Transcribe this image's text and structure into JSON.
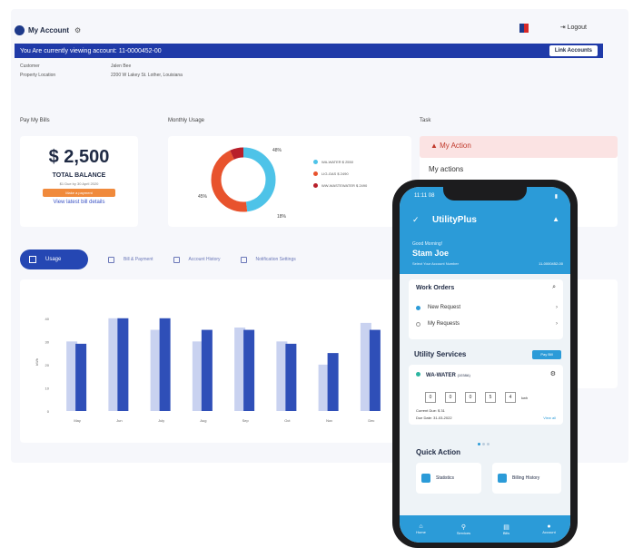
{
  "header": {
    "account_title": "My Account",
    "logout_label": "Logout"
  },
  "banner": {
    "text": "You Are currently viewing account: 11-0000452-00",
    "link_accounts": "Link Accounts"
  },
  "info": {
    "customer_label": "Customer",
    "customer_value": "Jalen Bee",
    "location_label": "Property Location",
    "location_value": "2200 W Lakey St. Lother, Louisiana"
  },
  "bills": {
    "section": "Pay My Bills",
    "amount": "$ 2,500",
    "label": "TOTAL BALANCE",
    "due": "$1 Due by 30 April 2020",
    "pay_button": "Make a payment",
    "view_bill": "View latest bill details"
  },
  "usage": {
    "section": "Monthly Usage",
    "legend": [
      "WA-WATER $ 2550",
      "LIG-GAS $ 2490",
      "WW-WASTEWATER $ 2490"
    ],
    "pct_top": "48%",
    "pct_left": "45%",
    "pct_bottom": "18%",
    "colors": {
      "water": "#4ec3e8",
      "gas": "#e8532d",
      "waste": "#b81f2a"
    }
  },
  "tasks": {
    "section": "Task",
    "action": "My Action",
    "my_actions": "My actions"
  },
  "tabs": {
    "usage": "Usage",
    "bill": "Bill & Payment",
    "history": "Account History",
    "notif": "Notification Settings"
  },
  "chart_data": {
    "type": "bar",
    "categories": [
      "May",
      "Jun",
      "July",
      "Aug",
      "Sep",
      "Oct",
      "Nov",
      "Dec"
    ],
    "series": [
      {
        "values": [
          30,
          40,
          35,
          30,
          36,
          30,
          20,
          38
        ]
      },
      {
        "values": [
          29,
          40,
          40,
          35,
          35,
          29,
          25,
          35
        ]
      }
    ],
    "ylabel": "kWh",
    "yticks": [
      "40",
      "30",
      "20",
      "10",
      "0"
    ],
    "ylim": [
      0,
      45
    ]
  },
  "phone": {
    "time": "11:11 08",
    "app": "UtilityPlus",
    "greeting": "Good Morning!",
    "name": "Stam Joe",
    "select": "Select Your Account Number",
    "account": "11-0000452-00",
    "work_orders": "Work Orders",
    "new_request": "New Request",
    "my_requests": "My Requests",
    "utility_services": "Utility Services",
    "pay_bill": "Pay Bill",
    "service_name": "WA-WATER",
    "service_id": "(1038A)",
    "digits": [
      "0",
      "0",
      "0",
      "5",
      "4"
    ],
    "unit": "kwh",
    "current_due": "Current Due: $ 31",
    "due_date": "Due Date: 31-03-2022",
    "view_all": "View all",
    "quick_action": "Quick Action",
    "statistics": "Statistics",
    "billing_history": "Billing History",
    "nav": [
      "Home",
      "Services",
      "Bills",
      "Account"
    ]
  }
}
